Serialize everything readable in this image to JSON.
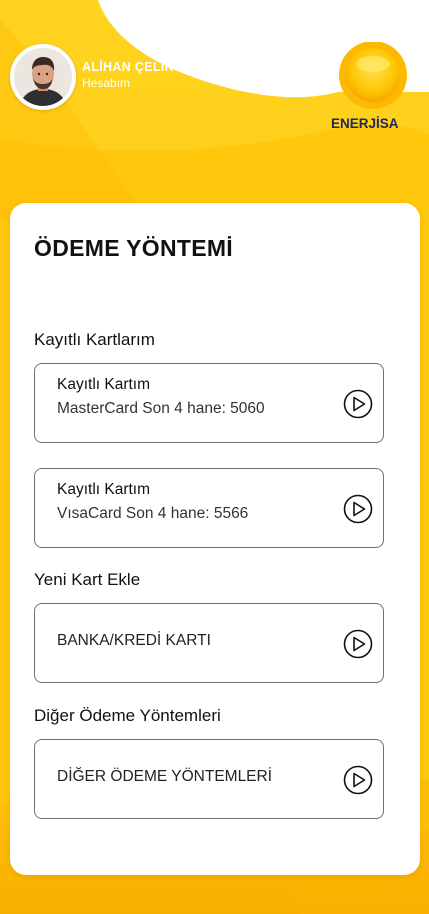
{
  "colors": {
    "background_yellow_light": "#FFD21F",
    "background_yellow_dark": "#F9B800",
    "card_background": "#FFFFFF",
    "text_primary": "#111111",
    "border": "#6F6F6F",
    "logo_text": "#1B2A5A",
    "logo_accent": "#29ABE2"
  },
  "header": {
    "user_name": "ALİHAN ÇELİK",
    "account_link": "Hesabım",
    "avatar_icon": "user-avatar-photo",
    "logo_text": "ENERJİSA"
  },
  "main": {
    "title": "ÖDEME YÖNTEMİ",
    "saved_cards_section": {
      "title": "Kayıtlı Kartlarım",
      "cards": [
        {
          "title": "Kayıtlı Kartım",
          "detail": "MasterCard Son 4 hane: 5060",
          "icon": "play-circle-icon"
        },
        {
          "title": "Kayıtlı Kartım",
          "detail": "VısaCard Son 4 hane: 5566",
          "icon": "play-circle-icon"
        }
      ]
    },
    "new_card_section": {
      "title": "Yeni Kart Ekle",
      "option_label": "BANKA/KREDİ KARTI",
      "icon": "play-circle-icon"
    },
    "other_methods_section": {
      "title": "Diğer Ödeme Yöntemleri",
      "option_label": "DİĞER ÖDEME YÖNTEMLERİ",
      "icon": "play-circle-icon"
    }
  }
}
